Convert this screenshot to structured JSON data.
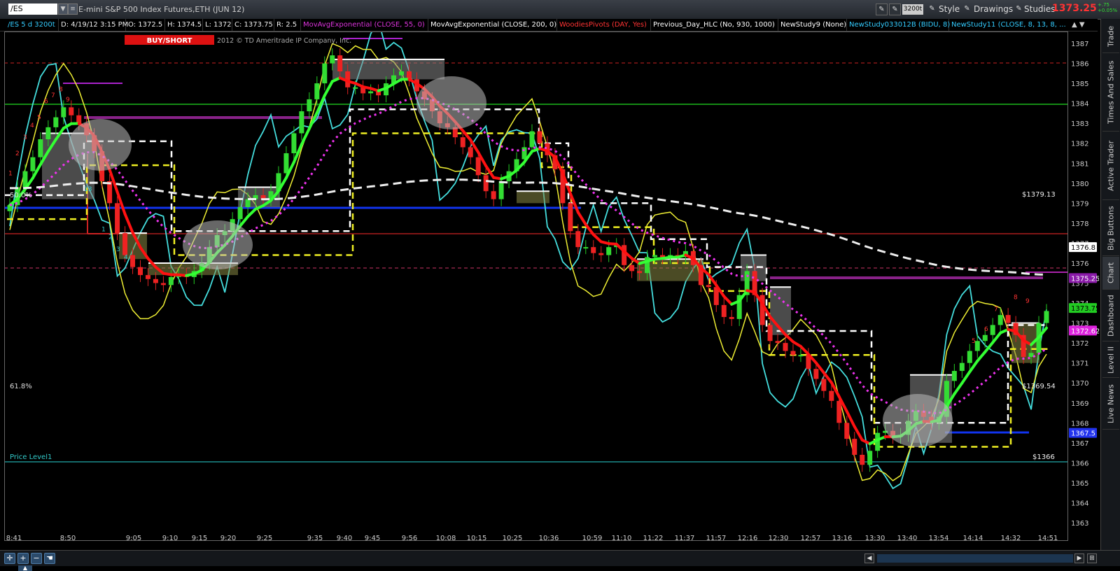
{
  "header": {
    "symbol": "/ES",
    "title": "E-mini S&P 500 Index Futures,ETH (JUN 12)",
    "aggregation": "3200t",
    "style_label": "Style",
    "drawings_label": "Drawings",
    "studies_label": "Studies",
    "last_price": "1373.25",
    "change_line1": "+.75",
    "change_line2": "+0.05%"
  },
  "study_bar": {
    "chart_desc": "/ES 5 d 3200t",
    "date": "D: 4/19/12 3:15 PM",
    "open": "O: 1372.5",
    "high": "H: 1374.5",
    "low": "L: 1372",
    "close": "C: 1373.75",
    "range": "R: 2.5",
    "study1": "MovAvgExponential (CLOSE, 55, 0)",
    "study2": "MovAvgExponential (CLOSE, 200, 0)",
    "study3": "WoodiesPivots (DAY, Yes)",
    "study4": "Previous_Day_HLC (No, 930, 1000)",
    "study5": "NewStudy9 (None)",
    "study6": "NewStudy033012B (BIDU, 8)",
    "study7": "NewStudy11 (CLOSE, 8, 13, 8, ..."
  },
  "chart": {
    "buy_short_label": "BUY/SHORT",
    "copyright": "2012 © TD Ameritrade IP Company, Inc.",
    "fib_50": "50.0%",
    "fib_618": "61.8%",
    "price_level_label": "Price Level1",
    "label_1379": "$1379.13",
    "label_1369": "$1369.54",
    "label_1366": "$1366",
    "price_axis": [
      "1387",
      "1386",
      "1385",
      "1384",
      "1383",
      "1382",
      "1381",
      "1380",
      "1379",
      "1378",
      "1377",
      "1376",
      "1375",
      "1374",
      "1373",
      "1372",
      "1371",
      "1370",
      "1369",
      "1368",
      "1367",
      "1366",
      "1365",
      "1364",
      "1363"
    ],
    "time_axis": [
      "8:41",
      "8:50",
      "9:05",
      "9:10",
      "9:15",
      "9:20",
      "9:25",
      "9:35",
      "9:40",
      "9:45",
      "9:56",
      "10:08",
      "10:15",
      "10:25",
      "10:36",
      "10:59",
      "11:10",
      "11:22",
      "11:37",
      "11:57",
      "12:16",
      "12:30",
      "12:57",
      "13:16",
      "13:30",
      "13:40",
      "13:54",
      "14:14",
      "14:32",
      "14:51"
    ],
    "axis_tags": [
      {
        "text": "1376.8",
        "color": "#ffffff",
        "bg": "#ffffff",
        "fg": "#000000"
      },
      {
        "text": "1375.25",
        "color": "#a020c0",
        "bg": "#8a1aa8",
        "fg": "#ffffff"
      },
      {
        "text": "1373.75",
        "color": "#22dd22",
        "bg": "#22cc22",
        "fg": "#000000"
      },
      {
        "text": "1372.62",
        "color": "#ee22ee",
        "bg": "#dd22dd",
        "fg": "#ffffff"
      },
      {
        "text": "1367.5",
        "color": "#2222ff",
        "bg": "#2233ee",
        "fg": "#ffffff"
      }
    ],
    "seq_numbers": [
      "1",
      "2",
      "3",
      "4",
      "5",
      "6",
      "7",
      "8",
      "9",
      "13",
      "1",
      "2",
      "3",
      "4",
      "5",
      "6",
      "7",
      "8",
      "9"
    ]
  },
  "chart_data": {
    "type": "candlestick",
    "y_range": [
      1363,
      1387.4
    ],
    "closes": [
      1378.9,
      1379.8,
      1380.6,
      1381.3,
      1382.2,
      1382.8,
      1383.3,
      1383.8,
      1383.4,
      1383.0,
      1382.4,
      1381.6,
      1380.1,
      1379.0,
      1377.5,
      1376.4,
      1375.8,
      1375.4,
      1375.2,
      1375.0,
      1374.9,
      1375.3,
      1375.4,
      1375.3,
      1375.6,
      1376.0,
      1376.8,
      1377.4,
      1377.6,
      1378.2,
      1378.8,
      1379.2,
      1379.4,
      1379.2,
      1379.6,
      1380.5,
      1381.5,
      1382.5,
      1383.6,
      1384.2,
      1385.0,
      1386.0,
      1386.4,
      1385.6,
      1384.8,
      1384.8,
      1384.5,
      1384.6,
      1384.4,
      1385.0,
      1385.4,
      1385.6,
      1385.2,
      1384.6,
      1384.2,
      1383.6,
      1383.0,
      1382.8,
      1382.3,
      1381.8,
      1381.3,
      1380.4,
      1379.6,
      1379.2,
      1380.1,
      1380.6,
      1381.2,
      1381.8,
      1382.6,
      1382.0,
      1381.4,
      1380.7,
      1379.0,
      1377.6,
      1376.8,
      1376.8,
      1376.5,
      1376.4,
      1376.8,
      1376.9,
      1375.9,
      1375.6,
      1375.5,
      1376.3,
      1376.4,
      1376.3,
      1376.4,
      1376.3,
      1376.6,
      1375.9,
      1374.9,
      1374.8,
      1373.9,
      1373.3,
      1373.2,
      1374.4,
      1375.6,
      1374.4,
      1372.9,
      1372.1,
      1372.0,
      1371.6,
      1371.4,
      1371.4,
      1370.7,
      1370.2,
      1369.6,
      1369.1,
      1368.0,
      1367.2,
      1366.4,
      1365.9,
      1366.6,
      1367.5,
      1367.6,
      1367.3,
      1367.4,
      1368.1,
      1368.6,
      1368.3,
      1368.0,
      1368.3,
      1370.1,
      1370.6,
      1371.0,
      1371.6,
      1372.1,
      1372.4,
      1372.9,
      1373.4,
      1373.0,
      1372.4,
      1371.3,
      1371.5,
      1373.0,
      1373.6
    ]
  },
  "right_tabs": [
    "Trade",
    "Times And Sales",
    "Active Trader",
    "Big Buttons",
    "Chart",
    "Dashboard",
    "Level II",
    "Live News"
  ]
}
